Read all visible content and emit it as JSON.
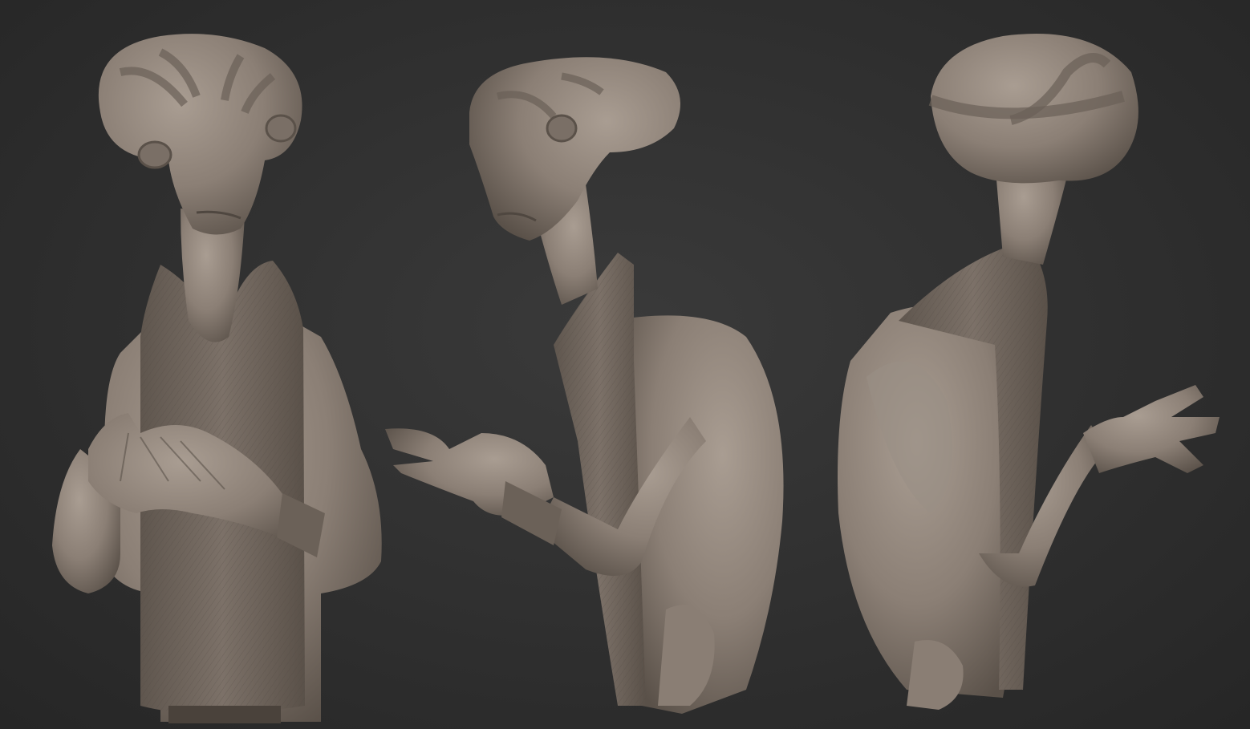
{
  "scene": {
    "background": "#2c2c2c",
    "material": "#8a7e74",
    "material_light": "#a59a8f",
    "material_dark": "#5c534b",
    "views": [
      {
        "name": "front-view"
      },
      {
        "name": "three-quarter-view"
      },
      {
        "name": "back-view"
      }
    ]
  }
}
